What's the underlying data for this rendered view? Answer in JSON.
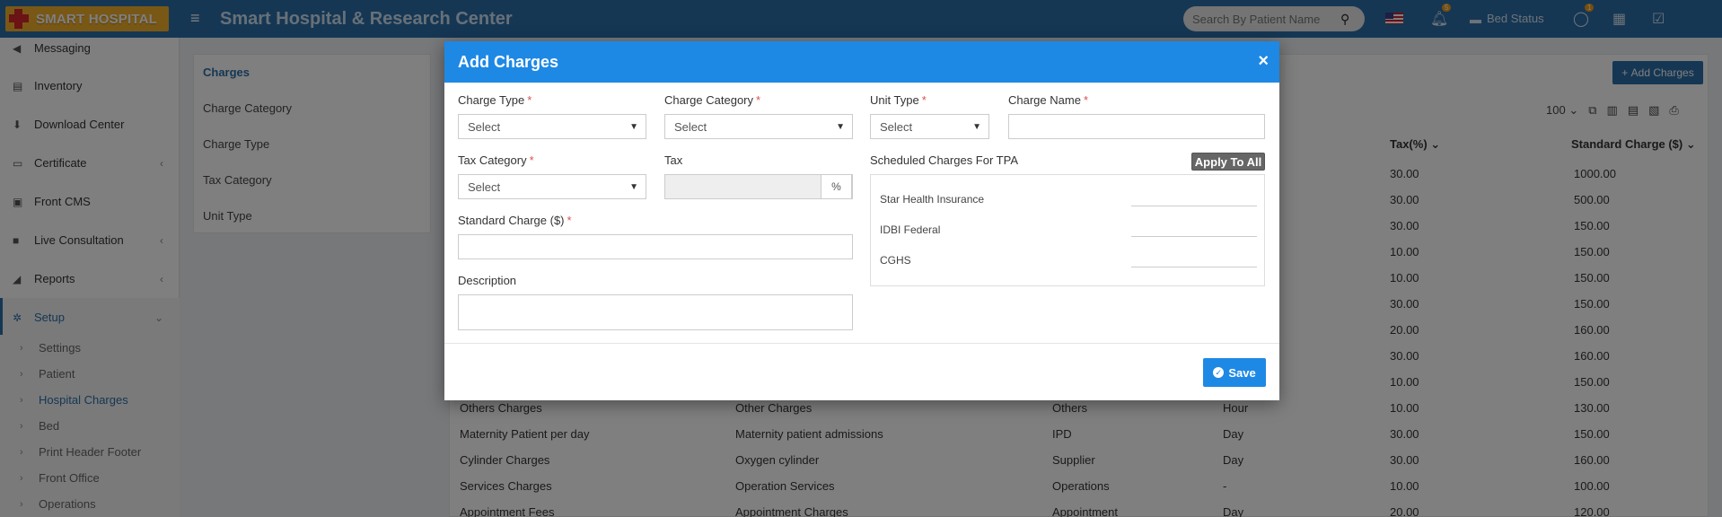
{
  "header": {
    "logo_text": "SMART HOSPITAL",
    "app_title": "Smart Hospital & Research Center",
    "search_placeholder": "Search By Patient Name",
    "notification_count": "5",
    "whatsapp_count": "1",
    "bed_status_label": "Bed Status"
  },
  "sidebar": {
    "items": [
      {
        "label": "Messaging",
        "icon": "bullhorn-icon"
      },
      {
        "label": "Inventory",
        "icon": "inventory-icon"
      },
      {
        "label": "Download Center",
        "icon": "download-icon"
      },
      {
        "label": "Certificate",
        "icon": "certificate-icon"
      },
      {
        "label": "Front CMS",
        "icon": "cms-icon"
      },
      {
        "label": "Live Consultation",
        "icon": "video-icon"
      },
      {
        "label": "Reports",
        "icon": "chart-icon"
      },
      {
        "label": "Setup",
        "icon": "gears-icon"
      }
    ],
    "setup_sub": [
      "Settings",
      "Patient",
      "Hospital Charges",
      "Bed",
      "Print Header Footer",
      "Front Office",
      "Operations"
    ]
  },
  "charges_menu": [
    "Charges",
    "Charge Category",
    "Charge Type",
    "Tax Category",
    "Unit Type"
  ],
  "page": {
    "add_button": "Add Charges",
    "page_size": "100",
    "col_tax": "Tax(%)",
    "col_standard": "Standard Charge ($)",
    "bg_rows": [
      {
        "tax": "30.00",
        "std": "1000.00"
      },
      {
        "tax": "30.00",
        "std": "500.00"
      },
      {
        "tax": "30.00",
        "std": "150.00"
      },
      {
        "tax": "10.00",
        "std": "150.00"
      },
      {
        "tax": "10.00",
        "std": "150.00"
      },
      {
        "tax": "30.00",
        "std": "150.00"
      },
      {
        "tax": "20.00",
        "std": "160.00"
      },
      {
        "tax": "30.00",
        "std": "160.00"
      },
      {
        "tax": "10.00",
        "std": "150.00"
      }
    ],
    "visible_rows": [
      {
        "name": "Others Charges",
        "category": "Other Charges",
        "type": "Others",
        "unit": "Hour",
        "tax": "10.00",
        "std": "130.00"
      },
      {
        "name": "Maternity Patient per day",
        "category": "Maternity patient admissions",
        "type": "IPD",
        "unit": "Day",
        "tax": "30.00",
        "std": "150.00"
      },
      {
        "name": "Cylinder Charges",
        "category": "Oxygen cylinder",
        "type": "Supplier",
        "unit": "Day",
        "tax": "30.00",
        "std": "160.00"
      },
      {
        "name": "Services Charges",
        "category": "Operation Services",
        "type": "Operations",
        "unit": "-",
        "tax": "10.00",
        "std": "100.00"
      },
      {
        "name": "Appointment Fees",
        "category": "Appointment Charges",
        "type": "Appointment",
        "unit": "Day",
        "tax": "20.00",
        "std": "120.00"
      }
    ]
  },
  "modal": {
    "title": "Add Charges",
    "close": "×",
    "charge_type_label": "Charge Type",
    "charge_category_label": "Charge Category",
    "unit_type_label": "Unit Type",
    "charge_name_label": "Charge Name",
    "tax_category_label": "Tax Category",
    "tax_label": "Tax",
    "tax_suffix": "%",
    "standard_charge_label": "Standard Charge ($)",
    "description_label": "Description",
    "select_text": "Select",
    "required_mark": "*",
    "tpa_label": "Scheduled Charges For TPA",
    "apply_all": "Apply To All",
    "tpa_rows": [
      "Star Health Insurance",
      "IDBI Federal",
      "CGHS"
    ],
    "save": "Save"
  }
}
